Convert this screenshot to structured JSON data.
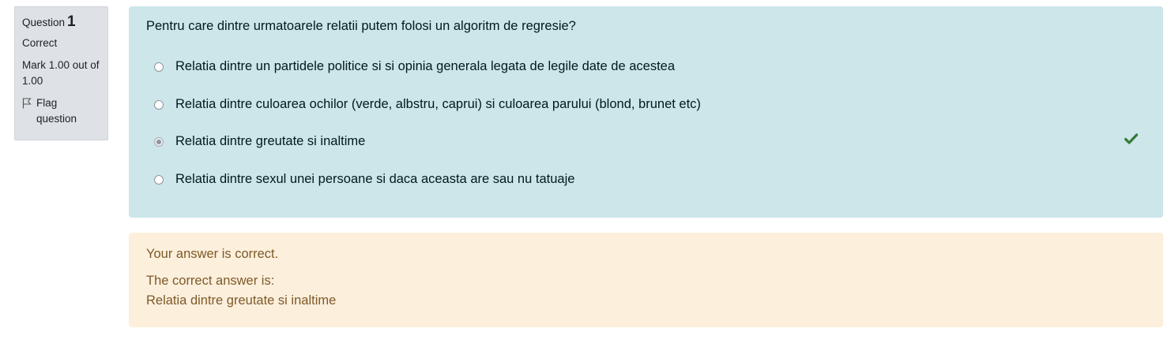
{
  "info": {
    "question_label": "Question",
    "question_number": "1",
    "state": "Correct",
    "grade": "Mark 1.00 out of 1.00",
    "flag_label": "Flag question"
  },
  "question": {
    "text": "Pentru care dintre urmatoarele relatii putem folosi un algoritm de regresie?",
    "answers": [
      {
        "label": "Relatia dintre un partidele politice si si opinia generala legata de legile date de acestea",
        "selected": false
      },
      {
        "label": "Relatia dintre culoarea ochilor (verde, albstru, caprui) si culoarea parului (blond, brunet etc)",
        "selected": false
      },
      {
        "label": "Relatia dintre greutate si inaltime",
        "selected": true
      },
      {
        "label": "Relatia dintre sexul unei persoane si daca aceasta are sau nu tatuaje",
        "selected": false
      }
    ],
    "correct_icon": "check-icon"
  },
  "outcome": {
    "feedback": "Your answer is correct.",
    "right_answer_title": "The correct answer is:",
    "right_answer": "Relatia dintre greutate si inaltime"
  },
  "colors": {
    "info_bg": "#dee2e6",
    "question_bg": "#cce6ea",
    "outcome_bg": "#fcefdc",
    "correct_green": "#357a32"
  }
}
